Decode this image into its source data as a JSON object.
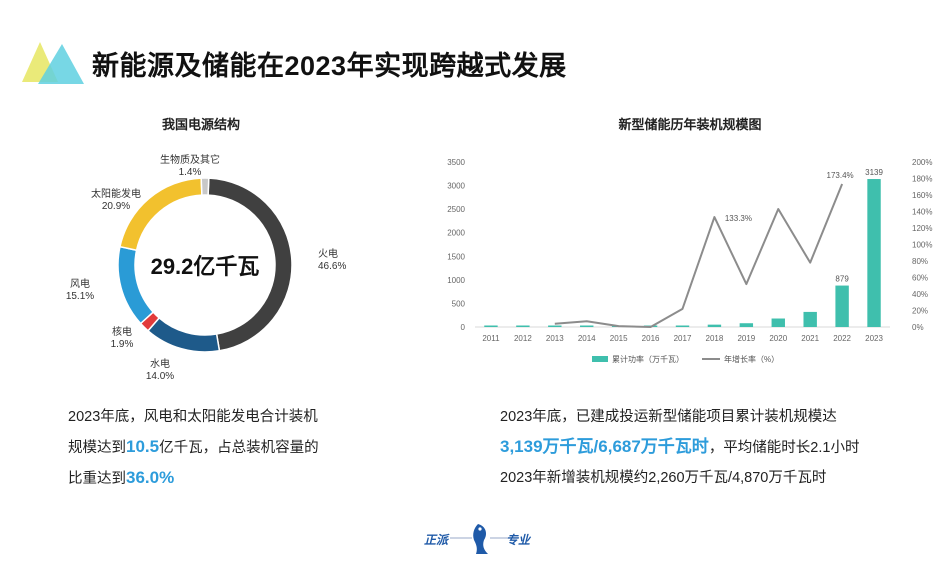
{
  "page": {
    "title": "新能源及储能在2023年实现跨越式发展",
    "colors": {
      "accent_blue": "#2d9cdb",
      "logo_yellow": "#e8e86a",
      "logo_cyan": "#5fd0e0"
    }
  },
  "left_panel": {
    "title": "我国电源结构",
    "note": {
      "line1": "2023年底，风电和太阳能发电合计装机",
      "line2_pre": "规模达到",
      "line2_hl": "10.5",
      "line2_post": "亿千瓦，占总装机容量的",
      "line3_pre": "比重达到",
      "line3_hl": "36.0%"
    }
  },
  "right_panel": {
    "title": "新型储能历年装机规模图",
    "note": {
      "line1": "2023年底，已建成投运新型储能项目累计装机规模达",
      "line2_hl": "3,139万千瓦/6,687万千瓦时",
      "line2_post": "，平均储能时长2.1小时",
      "line3": "2023年新增装机规模约2,260万千瓦/4,870万千瓦时"
    }
  },
  "footer": {
    "left": "正派",
    "right": "专业"
  },
  "chart_data": [
    {
      "type": "pie",
      "title": "我国电源结构",
      "center_label": "29.2亿千瓦",
      "slices": [
        {
          "name": "火电",
          "value": 46.6,
          "label": "46.6%",
          "color": "#404040"
        },
        {
          "name": "水电",
          "value": 14.0,
          "label": "14.0%",
          "color": "#1e5a8a"
        },
        {
          "name": "核电",
          "value": 1.9,
          "label": "1.9%",
          "color": "#e23b3b"
        },
        {
          "name": "风电",
          "value": 15.1,
          "label": "15.1%",
          "color": "#2a9bd6"
        },
        {
          "name": "太阳能发电",
          "value": 20.9,
          "label": "20.9%",
          "color": "#f2c12e"
        },
        {
          "name": "生物质及其它",
          "value": 1.4,
          "label": "1.4%",
          "color": "#c8c8c8"
        }
      ]
    },
    {
      "type": "bar",
      "title": "新型储能历年装机规模图",
      "categories": [
        "2011",
        "2012",
        "2013",
        "2014",
        "2015",
        "2016",
        "2017",
        "2018",
        "2019",
        "2020",
        "2021",
        "2022",
        "2023"
      ],
      "y_left": {
        "ticks": [
          "0",
          "500",
          "1000",
          "1500",
          "2000",
          "2500",
          "3000",
          "3500"
        ],
        "ylim": [
          0,
          3500
        ]
      },
      "y_right": {
        "ticks": [
          "0%",
          "20%",
          "40%",
          "60%",
          "80%",
          "100%",
          "120%",
          "140%",
          "160%",
          "180%",
          "200%"
        ],
        "ylim": [
          0,
          200
        ]
      },
      "series": [
        {
          "name": "累计功率（万千瓦）",
          "type": "bar",
          "color": "#3fbfad",
          "values": [
            3,
            4,
            6,
            9,
            10,
            11,
            21,
            50,
            80,
            180,
            320,
            879,
            3139
          ],
          "data_labels": {
            "11": "879",
            "12": "3139"
          }
        },
        {
          "name": "年增长率（%）",
          "type": "line",
          "axis": "right",
          "color": "#8c8c8c",
          "values": [
            null,
            null,
            4,
            7,
            1,
            0,
            22,
            133.3,
            52,
            143,
            78,
            173.4,
            null
          ],
          "data_labels": {
            "7": "133.3%",
            "11": "173.4%"
          }
        }
      ]
    }
  ]
}
